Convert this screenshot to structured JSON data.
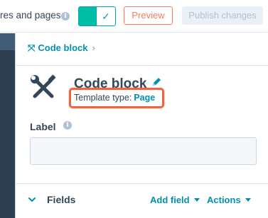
{
  "topbar": {
    "label": "res and pages",
    "info_icon": "info-icon",
    "toggle_icon": "check-icon",
    "preview_label": "Preview",
    "publish_label": "Publish changes"
  },
  "breadcrumb": {
    "icon": "tools-icon",
    "label": "Code block",
    "chevron": "›"
  },
  "module": {
    "icon": "tools-icon",
    "title": "Code block",
    "edit_icon": "pencil-icon",
    "template_type_label": "Template type:",
    "template_type_value": "Page"
  },
  "label_field": {
    "label": "Label",
    "value": "",
    "placeholder": ""
  },
  "fields_section": {
    "title": "Fields",
    "add_field_label": "Add field",
    "actions_label": "Actions"
  },
  "colors": {
    "accent_teal": "#0091ae",
    "toggle_on": "#00bda5",
    "preview_orange": "#ff7a59",
    "highlight_box": "#f2643d",
    "sidebar_dark": "#2d3e50"
  }
}
